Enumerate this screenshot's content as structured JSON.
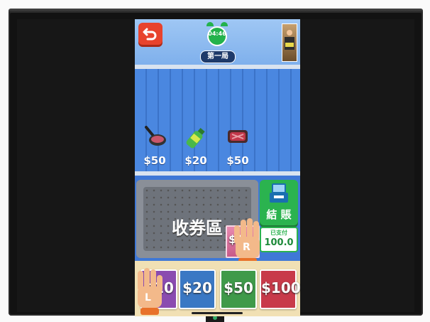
{
  "game": {
    "timer": "04:46",
    "round_label": "第一局",
    "checkout_label": "結 賬",
    "tray_label": "收券區",
    "paid": {
      "label": "已支付",
      "amount": "100.0"
    },
    "shelf_items": [
      {
        "name": "frying-pan",
        "price": "$50"
      },
      {
        "name": "bottle",
        "price": "$20"
      },
      {
        "name": "meat",
        "price": "$50"
      }
    ],
    "bills": [
      {
        "label": "$10",
        "color": "#8a4bb0"
      },
      {
        "label": "$20",
        "color": "#3a78c4"
      },
      {
        "label": "$50",
        "color": "#3f9a4a"
      },
      {
        "label": "$100",
        "color": "#c83a4a"
      }
    ],
    "tray_bill_label": "$1",
    "hands": {
      "left": "L",
      "right": "R"
    }
  },
  "colors": {
    "accent": "#2bb34f",
    "back_button": "#e8432d",
    "background": "#3f78d6"
  }
}
